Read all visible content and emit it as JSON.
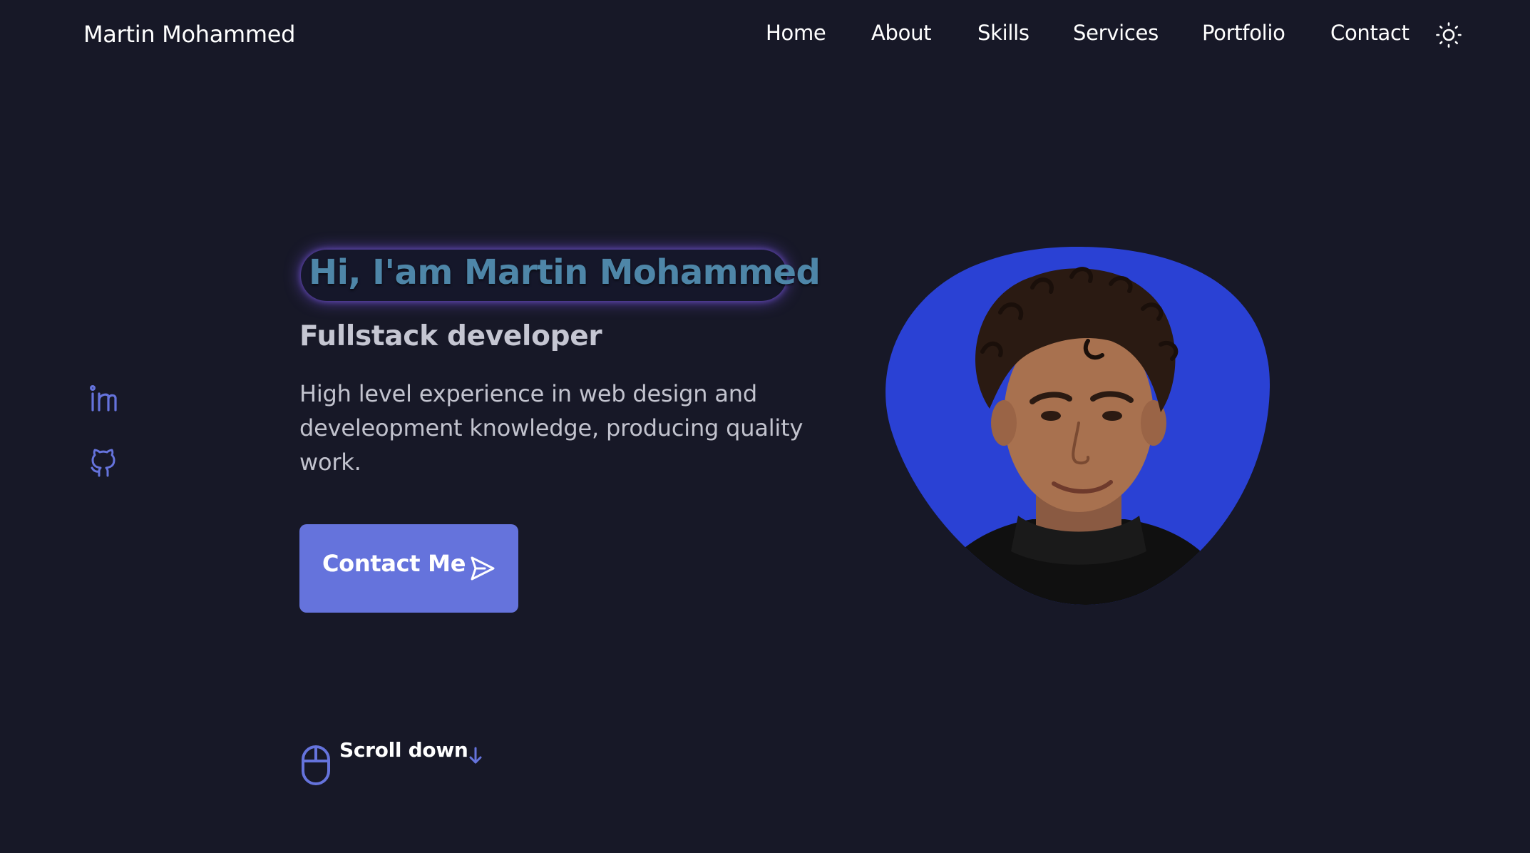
{
  "header": {
    "brand": "Martin Mohammed",
    "nav": [
      {
        "label": "Home"
      },
      {
        "label": "About"
      },
      {
        "label": "Skills"
      },
      {
        "label": "Services"
      },
      {
        "label": "Portfolio"
      },
      {
        "label": "Contact"
      }
    ],
    "theme_toggle_icon": "sun-icon"
  },
  "social": [
    {
      "icon": "linkedin-icon"
    },
    {
      "icon": "github-icon"
    }
  ],
  "hero": {
    "title": "Hi, I'am Martin Mohammed",
    "subtitle": "Fullstack developer",
    "description": "High level experience in web design and develeopment knowledge, producing quality work.",
    "contact_button": {
      "label": "Contact Me",
      "icon": "send-icon"
    },
    "scroll": {
      "label": "Scroll down",
      "icon": "mouse-icon",
      "arrow_icon": "arrow-down-icon"
    }
  },
  "portrait": {
    "icon": "profile-photo"
  },
  "colors": {
    "background": "#171827",
    "accent": "#6573dc",
    "blob": "#2a41d4",
    "title_text": "#4e86a8"
  }
}
